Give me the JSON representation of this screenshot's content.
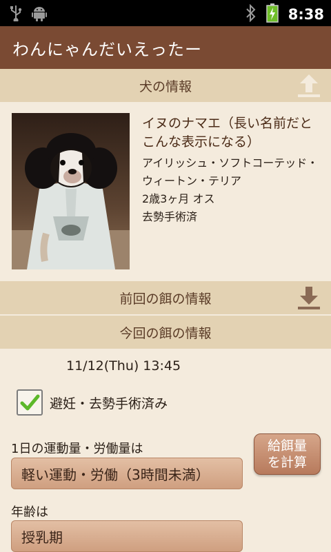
{
  "statusbar": {
    "time": "8:38",
    "icons": [
      "usb-icon",
      "android-icon",
      "bluetooth-icon",
      "battery-charging-icon"
    ]
  },
  "app": {
    "title": "わんにゃんだいえったー"
  },
  "dog_section": {
    "header": "犬の情報",
    "header_icon": "upload-arrow-icon"
  },
  "dog": {
    "name": "イヌのナマエ（長い名前だとこんな表示になる）",
    "breed": "アイリッシュ・ソフトコーテッド・ウィートン・テリア",
    "age_sex": "2歳3ヶ月 オス",
    "status": "去勢手術済"
  },
  "previous_section": {
    "header": "前回の餌の情報",
    "header_icon": "download-arrow-icon"
  },
  "current_section": {
    "header": "今回の餌の情報"
  },
  "feeding": {
    "datetime": "11/12(Thu) 13:45",
    "neutered_label": "避妊・去勢手術済み",
    "neutered_checked": true,
    "activity_label": "1日の運動量・労働量は",
    "activity_value": "軽い運動・労働（3時間未満）",
    "age_label": "年齢は",
    "age_value": "授乳期",
    "calc_button": "給餌量\nを計算"
  },
  "colors": {
    "appbar": "#7a4a33",
    "section_header": "#e3d2b3",
    "background": "#f4ebdd",
    "button": "#c58d6f"
  }
}
